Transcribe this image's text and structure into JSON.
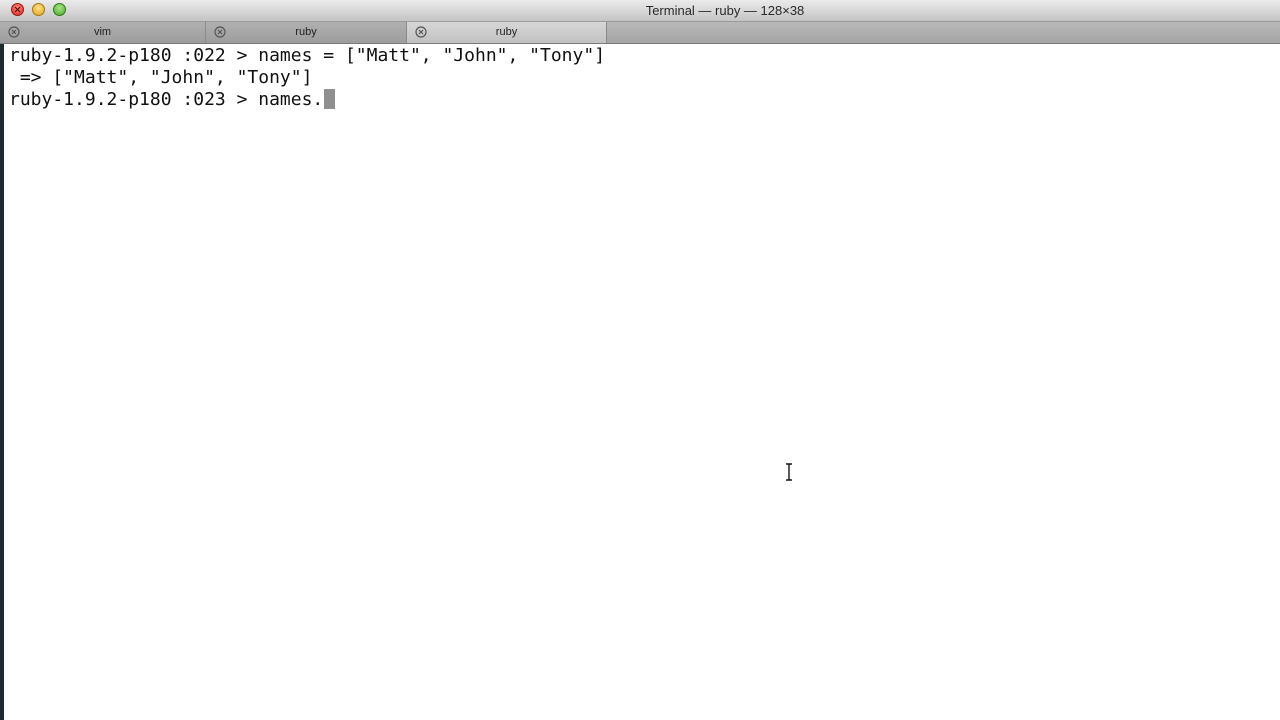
{
  "window": {
    "title": "Terminal — ruby — 128×38"
  },
  "tabs": [
    {
      "label": "vim",
      "active": false
    },
    {
      "label": "ruby",
      "active": false
    },
    {
      "label": "ruby",
      "active": true
    }
  ],
  "terminal": {
    "lines": [
      "ruby-1.9.2-p180 :022 > names = [\"Matt\", \"John\", \"Tony\"]",
      " => [\"Matt\", \"John\", \"Tony\"]",
      "ruby-1.9.2-p180 :023 > names."
    ]
  },
  "icons": {
    "close": "close-icon",
    "minimize": "minimize-icon",
    "zoom": "zoom-icon",
    "tab_close": "tab-close-icon",
    "text_cursor": "ibeam-cursor-icon"
  },
  "colors": {
    "background": "#ffffff",
    "text": "#111111",
    "cursor": "#8f8f8f"
  }
}
